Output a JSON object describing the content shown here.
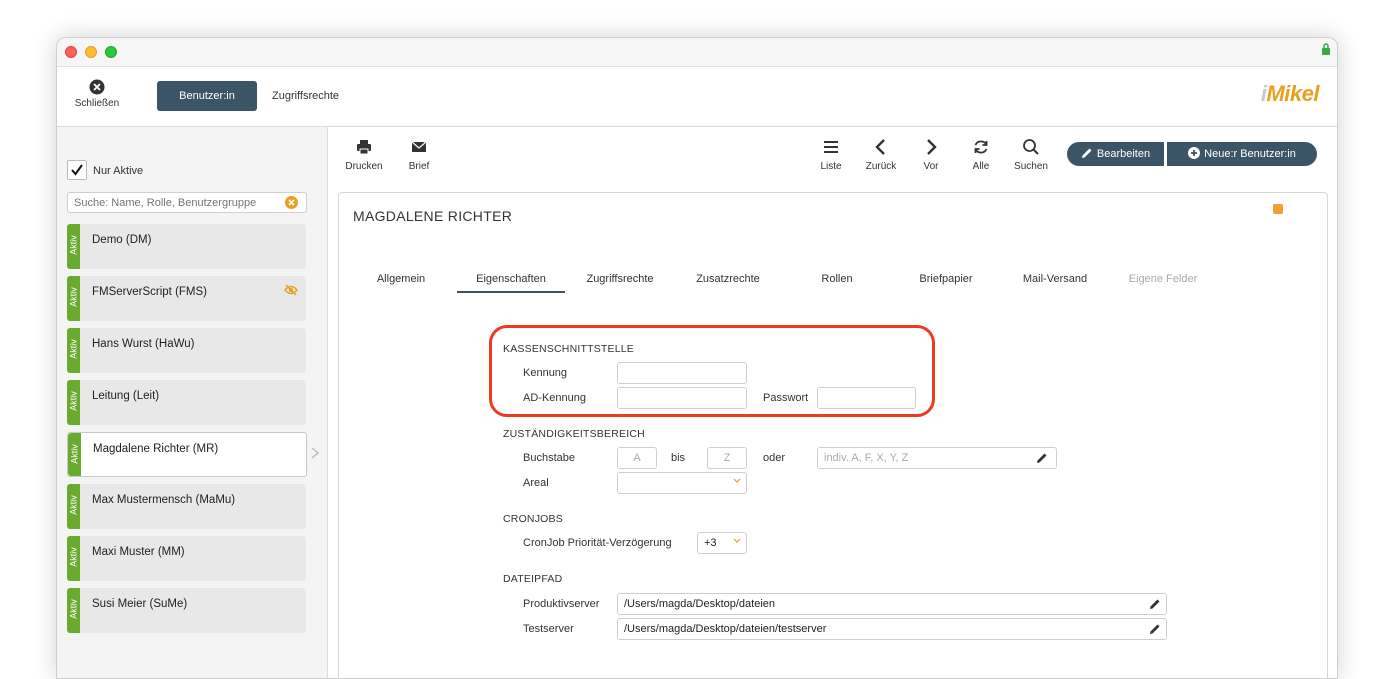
{
  "window": {
    "toolbar": {
      "close_label": "Schließen",
      "tab_user": "Benutzer:in",
      "tab_rights": "Zugriffsrechte",
      "logo_prefix": "i",
      "logo_text": "Mikel"
    },
    "sidebar": {
      "filter_label": "Nur Aktive",
      "filter_checked": true,
      "search_placeholder": "Suche: Name, Rolle, Benutzergruppe",
      "status_label": "Aktiv",
      "users": [
        {
          "name": "Demo (DM)",
          "status": "Aktiv"
        },
        {
          "name": "FMServerScript (FMS)",
          "status": "Aktiv",
          "hidden_icon": "eye-slash-icon"
        },
        {
          "name": "Hans Wurst (HaWu)",
          "status": "Aktiv"
        },
        {
          "name": "Leitung (Leit)",
          "status": "Aktiv"
        },
        {
          "name": "Magdalene Richter (MR)",
          "status": "Aktiv",
          "selected": true
        },
        {
          "name": "Max Mustermensch (MaMu)",
          "status": "Aktiv"
        },
        {
          "name": "Maxi Muster (MM)",
          "status": "Aktiv"
        },
        {
          "name": "Susi Meier (SuMe)",
          "status": "Aktiv"
        }
      ]
    },
    "actions": {
      "print": "Drucken",
      "letter": "Brief",
      "list": "Liste",
      "back": "Zurück",
      "forward": "Vor",
      "all": "Alle",
      "search": "Suchen",
      "edit": "Bearbeiten",
      "new_user": "Neue:r Benutzer:in"
    },
    "record": {
      "title": "MAGDALENE RICHTER",
      "tabs": [
        {
          "label": "Allgemein"
        },
        {
          "label": "Eigenschaften",
          "active": true
        },
        {
          "label": "Zugriffsrechte"
        },
        {
          "label": "Zusatzrechte"
        },
        {
          "label": "Rollen"
        },
        {
          "label": "Briefpapier"
        },
        {
          "label": "Mail-Versand"
        },
        {
          "label": "Eigene Felder",
          "disabled": true
        }
      ],
      "kassen": {
        "title": "KASSENSCHNITTSTELLE",
        "kennung_label": "Kennung",
        "kennung_value": "",
        "ad_label": "AD-Kennung",
        "ad_value": "",
        "pass_label": "Passwort",
        "pass_value": ""
      },
      "zust": {
        "title": "ZUSTÄNDIGKEITSBEREICH",
        "buchstabe_label": "Buchstabe",
        "from_placeholder": "A",
        "bis_label": "bis",
        "to_placeholder": "Z",
        "oder_label": "oder",
        "indiv_placeholder": "indiv. A, F, X, Y, Z",
        "areal_label": "Areal",
        "areal_value": ""
      },
      "cron": {
        "title": "CRONJOBS",
        "delay_label": "CronJob Priorität-Verzögerung",
        "delay_value": "+3"
      },
      "pfad": {
        "title": "DATEIPFAD",
        "prod_label": "Produktivserver",
        "prod_value": "/Users/magda/Desktop/dateien",
        "test_label": "Testserver",
        "test_value": "/Users/magda/Desktop/dateien/testserver"
      }
    },
    "colors": {
      "accent": "#3c5566",
      "active_badge": "#6aaa2e",
      "highlight": "#f03a20",
      "logo": "#e8a020"
    }
  }
}
